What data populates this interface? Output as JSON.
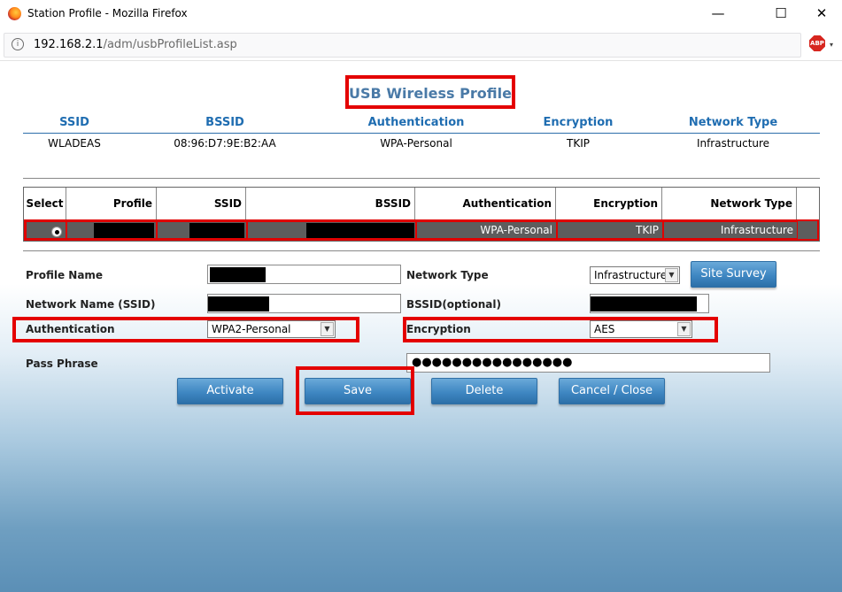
{
  "window": {
    "title": "Station Profile - Mozilla Firefox",
    "minimize": "—",
    "maximize": "☐",
    "close": "✕"
  },
  "urlbar": {
    "host": "192.168.2.1",
    "path": "/adm/usbProfileList.asp",
    "adblock": "ABP"
  },
  "page": {
    "title": "USB Wireless Profile"
  },
  "summary": {
    "headers": [
      "SSID",
      "BSSID",
      "Authentication",
      "Encryption",
      "Network Type"
    ],
    "values": [
      "WLADEAS",
      "08:96:D7:9E:B2:AA",
      "WPA-Personal",
      "TKIP",
      "Infrastructure"
    ]
  },
  "profile_table": {
    "headers": [
      "Select",
      "Profile",
      "SSID",
      "BSSID",
      "Authentication",
      "Encryption",
      "Network Type"
    ],
    "row": {
      "authentication": "WPA-Personal",
      "encryption": "TKIP",
      "network_type": "Infrastructure"
    }
  },
  "form": {
    "profile_name_label": "Profile Name",
    "network_name_label": "Network Name (SSID)",
    "authentication_label": "Authentication",
    "authentication_value": "WPA2-Personal",
    "pass_phrase_label": "Pass Phrase",
    "pass_phrase_masked": "●●●●●●●●●●●●●●●●",
    "network_type_label": "Network Type",
    "network_type_value": "Infrastructure",
    "bssid_label": "BSSID(optional)",
    "encryption_label": "Encryption",
    "encryption_value": "AES",
    "site_survey_label": "Site Survey"
  },
  "buttons": {
    "activate": "Activate",
    "save": "Save",
    "delete": "Delete",
    "cancel_close": "Cancel / Close"
  },
  "colors": {
    "highlight": "#e40000",
    "heading_blue": "#1f6db1",
    "button_blue": "#3f87c2"
  }
}
